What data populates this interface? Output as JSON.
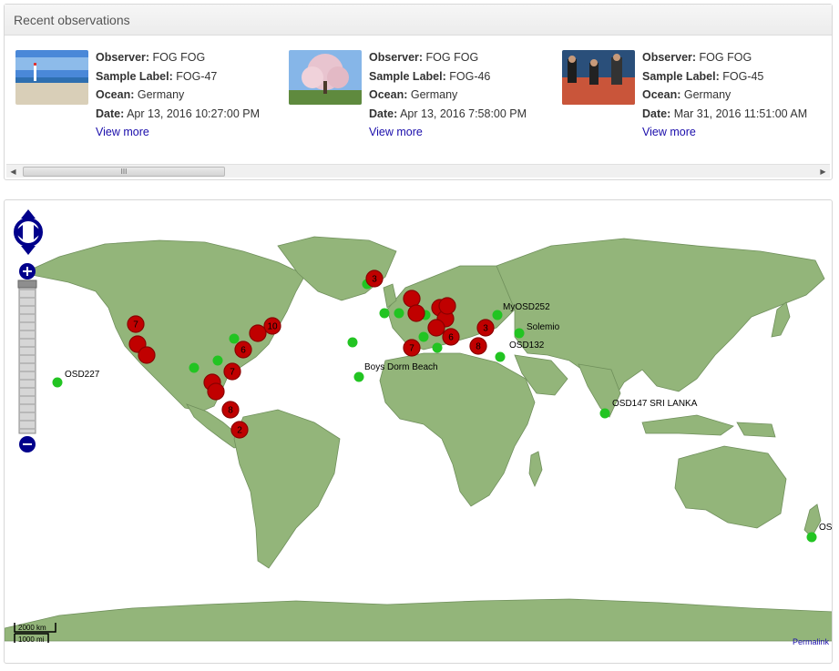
{
  "panel": {
    "title": "Recent observations",
    "observations": [
      {
        "observer_label": "Observer:",
        "observer": "FOG FOG",
        "sample_label_label": "Sample Label:",
        "sample_label": "FOG-47",
        "ocean_label": "Ocean:",
        "ocean": "Germany",
        "date_label": "Date:",
        "date": "Apr 13, 2016 10:27:00 PM",
        "more": "View more",
        "thumb": "beach"
      },
      {
        "observer_label": "Observer:",
        "observer": "FOG FOG",
        "sample_label_label": "Sample Label:",
        "sample_label": "FOG-46",
        "ocean_label": "Ocean:",
        "ocean": "Germany",
        "date_label": "Date:",
        "date": "Apr 13, 2016 7:58:00 PM",
        "more": "View more",
        "thumb": "blossom-tree"
      },
      {
        "observer_label": "Observer:",
        "observer": "FOG FOG",
        "sample_label_label": "Sample Label:",
        "sample_label": "FOG-45",
        "ocean_label": "Ocean:",
        "ocean": "Germany",
        "date_label": "Date:",
        "date": "Mar 31, 2016 11:51:00 AM",
        "more": "View more",
        "thumb": "boat-crew"
      }
    ],
    "scroll_left_icon": "left-arrow-icon",
    "scroll_right_icon": "right-arrow-icon",
    "scroll_grip": "III"
  },
  "map": {
    "permalink": "Permalink",
    "scale_km": "2000 km",
    "scale_mi": "1000 mi",
    "colors": {
      "land": "#93b57a",
      "land_stroke": "#6f8f5b",
      "cluster": "#c00000",
      "cluster_stroke": "#8a0000",
      "single": "#22c422",
      "control": "#00008b"
    },
    "clusters": [
      {
        "label": "3"
      },
      {
        "label": ""
      },
      {
        "label": ""
      },
      {
        "label": ""
      },
      {
        "label": ""
      },
      {
        "label": ""
      },
      {
        "label": "3"
      },
      {
        "label": "6"
      },
      {
        "label": ""
      },
      {
        "label": "7"
      },
      {
        "label": "8"
      },
      {
        "label": "7"
      },
      {
        "label": ""
      },
      {
        "label": ""
      },
      {
        "label": "10"
      },
      {
        "label": ""
      },
      {
        "label": "6"
      },
      {
        "label": "7"
      },
      {
        "label": ""
      },
      {
        "label": ""
      },
      {
        "label": "8"
      },
      {
        "label": "2"
      }
    ],
    "stations": [
      {
        "label": "OSD227"
      },
      {
        "label": "MyOSD252"
      },
      {
        "label": "Solemio"
      },
      {
        "label": "OSD132"
      },
      {
        "label": "Boys Dorm Beach"
      },
      {
        "label": "OSD147 SRI LANKA"
      },
      {
        "label": "OSD"
      },
      {
        "label": ""
      },
      {
        "label": ""
      },
      {
        "label": ""
      },
      {
        "label": ""
      },
      {
        "label": ""
      },
      {
        "label": ""
      },
      {
        "label": ""
      },
      {
        "label": ""
      },
      {
        "label": ""
      },
      {
        "label": ""
      }
    ]
  }
}
